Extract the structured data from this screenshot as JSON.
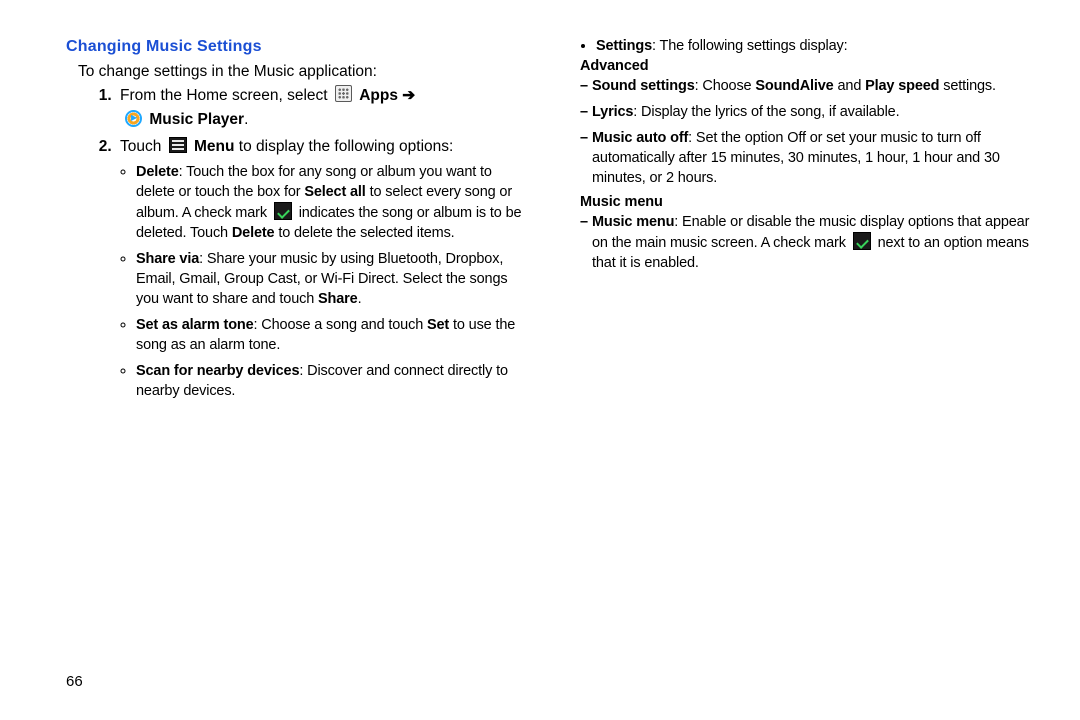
{
  "page_number": "66",
  "left": {
    "heading": "Changing Music Settings",
    "intro": "To change settings in the Music application:",
    "step1_a": "From the Home screen, select ",
    "step1_apps": "Apps",
    "step1_arrow": " ➔",
    "step1_music_player": "Music Player",
    "step2_a": "Touch ",
    "step2_menu": "Menu",
    "step2_b": " to display the following options:",
    "b1": {
      "lead": "Delete",
      "t1": ": Touch the box for any song or album you want to delete or touch the box for ",
      "select_all": "Select all",
      "t2": " to select every song or album. A check mark ",
      "t3": " indicates the song or album is to be deleted. Touch ",
      "delete2": "Delete",
      "t4": " to delete the selected items."
    },
    "b2": {
      "lead": "Share via",
      "t1": ": Share your music by using Bluetooth, Dropbox, Email, Gmail, Group Cast, or Wi-Fi Direct. Select the songs you want to share and touch ",
      "share": "Share",
      "t2": "."
    },
    "b3": {
      "lead": "Set as alarm tone",
      "t1": ": Choose a song and touch ",
      "set": "Set",
      "t2": " to use the song as an alarm tone."
    },
    "b4": {
      "lead": "Scan for nearby devices",
      "t1": ": Discover and connect directly to nearby devices."
    }
  },
  "right": {
    "lead_bold": "Settings",
    "lead_text": ": The following settings display:",
    "advanced_h": "Advanced",
    "d1": {
      "lead": "Sound settings",
      "t1": ": Choose ",
      "sa": "SoundAlive",
      "t2": " and ",
      "ps": "Play speed",
      "t3": " settings."
    },
    "d2": {
      "lead": "Lyrics",
      "t1": ": Display the lyrics of the song, if available."
    },
    "d3": {
      "lead": "Music auto off",
      "t1": ": Set the option Off or set your music to turn off automatically after 15 minutes, 30 minutes, 1 hour, 1 hour and 30 minutes, or 2 hours."
    },
    "music_menu_h": "Music menu",
    "d4": {
      "lead": "Music menu",
      "t1": ": Enable or disable the music display options that appear on the main music screen. A check mark ",
      "t2": " next to an option means that it is enabled."
    }
  }
}
